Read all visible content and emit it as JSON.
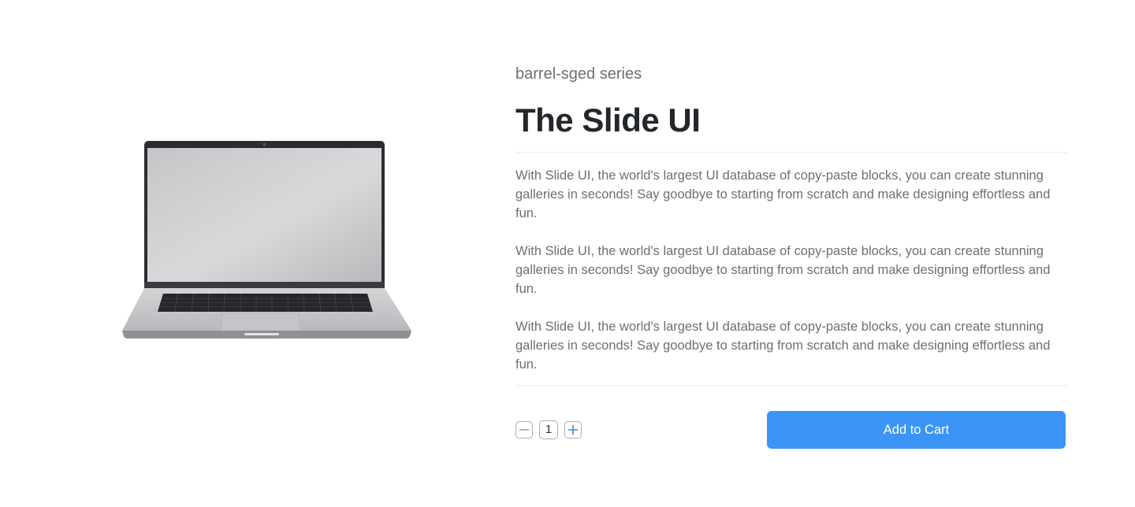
{
  "product": {
    "series": "barrel-sged series",
    "title": "The Slide UI",
    "descriptions": [
      "With Slide UI, the world's largest UI database of copy-paste blocks, you can create stunning galleries in seconds! Say goodbye to starting from scratch and make designing effortless and fun.",
      "With Slide UI, the world's largest UI database of copy-paste blocks, you can create stunning galleries in seconds! Say goodbye to starting from scratch and make designing effortless and fun.",
      "With Slide UI, the world's largest UI database of copy-paste blocks, you can create stunning galleries in seconds! Say goodbye to starting from scratch and make designing effortless and fun."
    ],
    "image_icon": "laptop-image"
  },
  "quantity": {
    "value": "1",
    "decrement_icon": "minus-icon",
    "increment_icon": "plus-icon"
  },
  "cart": {
    "add_label": "Add to Cart"
  },
  "colors": {
    "accent": "#3b94f5",
    "text_muted": "#6b6f74",
    "heading": "#23272b",
    "icon_blue": "#3b8ad9"
  }
}
